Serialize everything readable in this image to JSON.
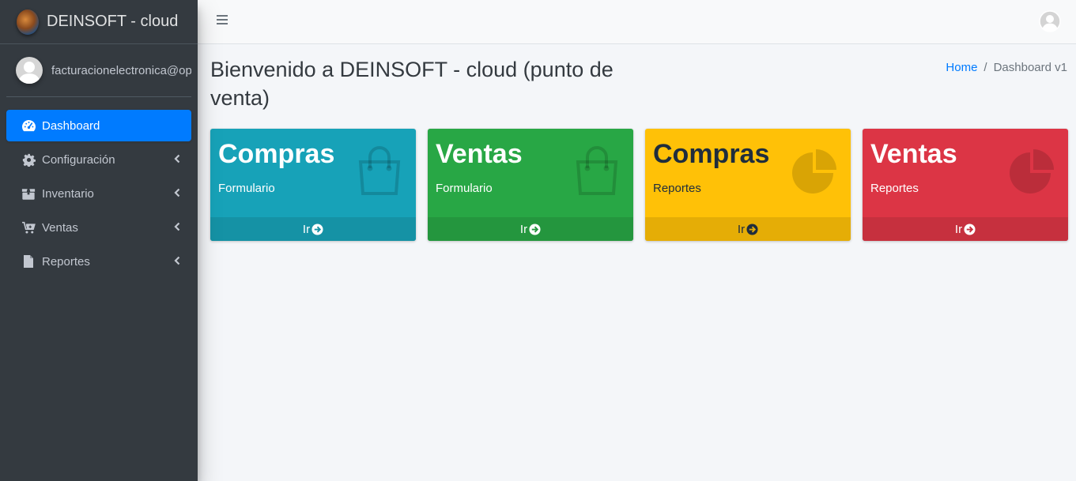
{
  "brand": {
    "name": "DEINSOFT - cloud"
  },
  "user": {
    "name": "facturacionelectronica@op"
  },
  "sidebar": {
    "items": [
      {
        "label": "Dashboard",
        "icon": "tachometer-icon",
        "active": true
      },
      {
        "label": "Configuración",
        "icon": "gear-icon"
      },
      {
        "label": "Inventario",
        "icon": "box-icon"
      },
      {
        "label": "Ventas",
        "icon": "cart-icon"
      },
      {
        "label": "Reportes",
        "icon": "file-icon"
      }
    ]
  },
  "header": {
    "title": "Bienvenido a DEINSOFT - cloud (punto de venta)"
  },
  "breadcrumb": {
    "home": "Home",
    "current": "Dashboard v1"
  },
  "boxes": [
    {
      "title": "Compras",
      "subtitle": "Formulario",
      "footer": "Ir",
      "icon": "shopping-bag-icon",
      "color": "#17a2b8"
    },
    {
      "title": "Ventas",
      "subtitle": "Formulario",
      "footer": "Ir",
      "icon": "shopping-bag-icon",
      "color": "#28a745"
    },
    {
      "title": "Compras",
      "subtitle": "Reportes",
      "footer": "Ir",
      "icon": "pie-chart-icon",
      "color": "#ffc107"
    },
    {
      "title": "Ventas",
      "subtitle": "Reportes",
      "footer": "Ir",
      "icon": "pie-chart-icon",
      "color": "#dc3545"
    }
  ]
}
